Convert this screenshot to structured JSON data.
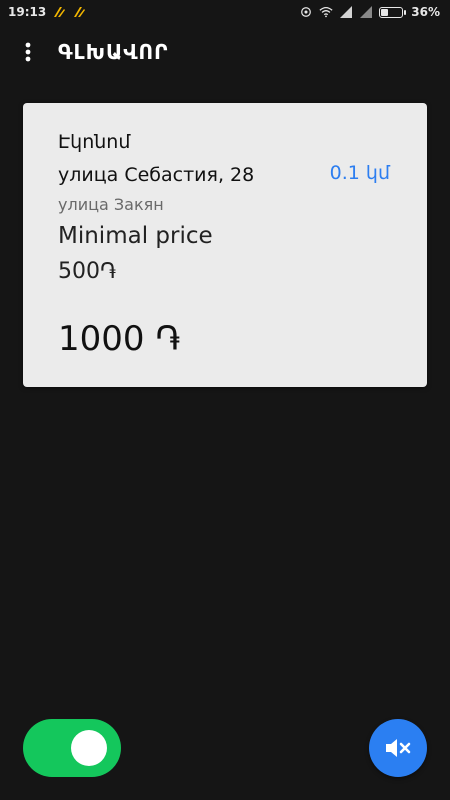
{
  "status_bar": {
    "time": "19:13",
    "battery_percent": "36%",
    "battery_level": 0.36,
    "icons": [
      "taxi-notification-icon",
      "taxi-notification-icon",
      "location-icon",
      "wifi-icon",
      "signal-icon",
      "signal-icon",
      "battery-icon"
    ]
  },
  "app_bar": {
    "menu_icon": "more-vertical-icon",
    "title": "ԳԼԽԱՎՈՐ"
  },
  "order": {
    "tariff": "Էկոնոմ",
    "pickup_address": "улица Себастия, 28",
    "distance": "0.1 կմ",
    "destination_address": "улица Закян",
    "min_price_label": "Minimal price",
    "min_price_value": "500֏",
    "price": "1000 ֏"
  },
  "controls": {
    "online_toggle_on": true,
    "mute_icon": "volume-mute-icon"
  },
  "colors": {
    "background": "#151515",
    "card": "#ebebeb",
    "accent_blue": "#2d7ef0",
    "toggle_green": "#14c75c",
    "mute_button": "#2b7ff2"
  }
}
